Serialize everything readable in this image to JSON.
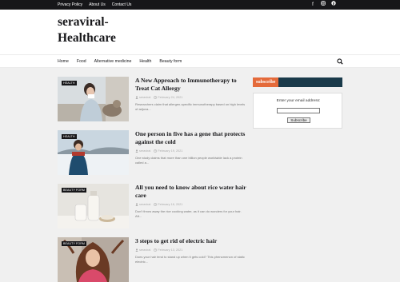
{
  "topnav": {
    "items": [
      "Privacy Policy",
      "About Us",
      "Contact Us"
    ]
  },
  "social": {
    "icons": [
      "facebook-icon",
      "instagram-icon",
      "pinterest-icon"
    ]
  },
  "site": {
    "title": "seraviral-Healthcare"
  },
  "menu": {
    "items": [
      "Home",
      "Food",
      "Alternative medicine",
      "Health",
      "Beauty form"
    ],
    "search_icon": "search-icon"
  },
  "posts": [
    {
      "tag": "HEALTH",
      "title": "A New Approach to Immunotherapy to Treat Cat Allergy",
      "author": "seraviral",
      "date": "February 24, 2021",
      "excerpt": "Researchers claim that allergen-specific immunotherapy based on high levels of adjuva..."
    },
    {
      "tag": "HEALTH",
      "title": "One person in five has a gene that protects against the cold",
      "author": "seraviral",
      "date": "February 19, 2021",
      "excerpt": "One study claims that more than one billion people worldwide lack a protein called a..."
    },
    {
      "tag": "BEAUTY FORM",
      "title": "All you need to know about rice water hair care",
      "author": "seraviral",
      "date": "February 16, 2021",
      "excerpt": "Don't throw away the rice cooking water, as it can do wonders for your hair. Aft..."
    },
    {
      "tag": "BEAUTY FORM",
      "title": "3 steps to get rid of electric hair",
      "author": "seraviral",
      "date": "February 13, 2021",
      "excerpt": "Does your hair tend to stand up when it gets cold? This phenomenon of static electric..."
    }
  ],
  "widget": {
    "title": "subscribe",
    "email_label": "Enter your email address:",
    "button": "Subscribe",
    "accent": "#e46a3a",
    "bar": "#1a3a4a"
  }
}
